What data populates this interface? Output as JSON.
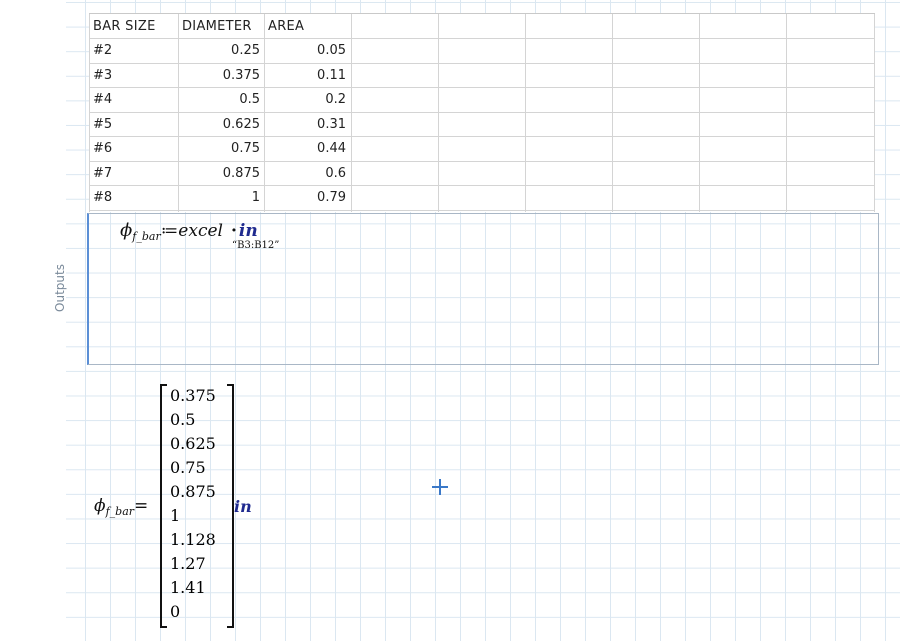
{
  "excel": {
    "headers": [
      "BAR SIZE",
      "DIAMETER",
      "AREA"
    ],
    "rows": [
      [
        "#2",
        "0.25",
        "0.05"
      ],
      [
        "#3",
        "0.375",
        "0.11"
      ],
      [
        "#4",
        "0.5",
        "0.2"
      ],
      [
        "#5",
        "0.625",
        "0.31"
      ],
      [
        "#6",
        "0.75",
        "0.44"
      ],
      [
        "#7",
        "0.875",
        "0.6"
      ],
      [
        "#8",
        "1",
        "0.79"
      ]
    ]
  },
  "outputs": {
    "label": "Outputs"
  },
  "definition": {
    "phi": "ϕ",
    "subscript": "f_bar",
    "assign": "≔",
    "function": "excel",
    "range": "“B3:B12”",
    "dot": "·",
    "unit": "in"
  },
  "result": {
    "phi": "ϕ",
    "subscript": "f_bar",
    "equals": "=",
    "values": [
      "0.375",
      "0.5",
      "0.625",
      "0.75",
      "0.875",
      "1",
      "1.128",
      "1.27",
      "1.41",
      "0"
    ],
    "unit": "in"
  }
}
